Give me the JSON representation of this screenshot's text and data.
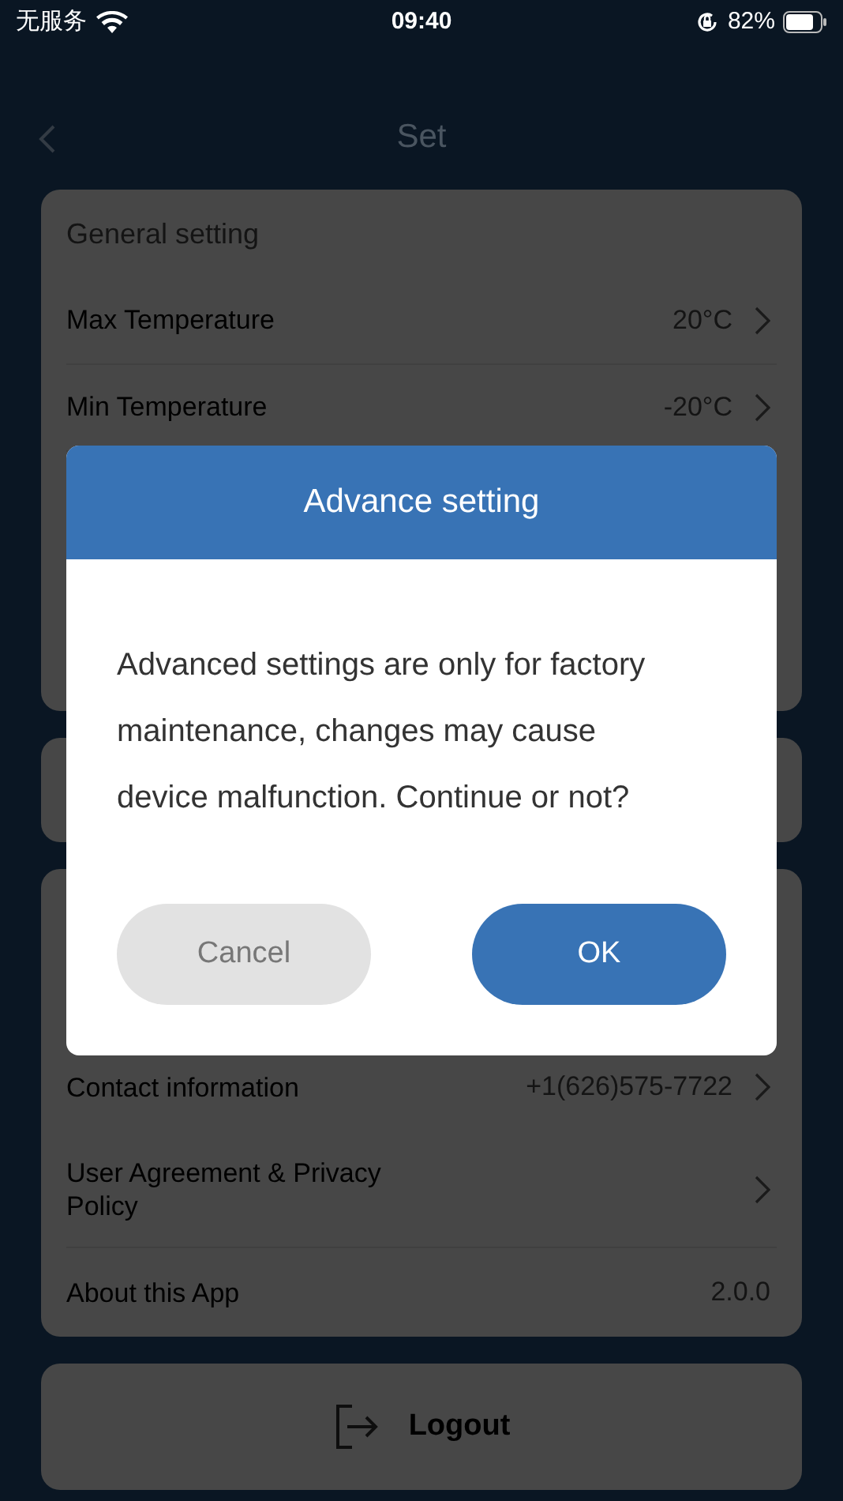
{
  "status_bar": {
    "carrier": "无服务",
    "time": "09:40",
    "battery": "82%"
  },
  "nav": {
    "title": "Set"
  },
  "general": {
    "header": "General setting",
    "rows": [
      {
        "label": "Max Temperature",
        "value": "20°C"
      },
      {
        "label": "Min Temperature",
        "value": "-20°C"
      }
    ]
  },
  "info_rows": [
    {
      "label": "Contact information",
      "value": "+1(626)575-7722",
      "chevron": true
    },
    {
      "label": "User Agreement & Privacy Policy",
      "chevron": true
    },
    {
      "label": "About this App",
      "value": "2.0.0",
      "chevron": false
    }
  ],
  "logout": {
    "label": "Logout"
  },
  "dialog": {
    "title": "Advance setting",
    "message": "Advanced settings are only for factory maintenance, changes may cause device malfunction. Continue or not?",
    "buttons": [
      {
        "label": "Cancel",
        "kind": "secondary"
      },
      {
        "label": "OK",
        "kind": "primary"
      }
    ]
  }
}
